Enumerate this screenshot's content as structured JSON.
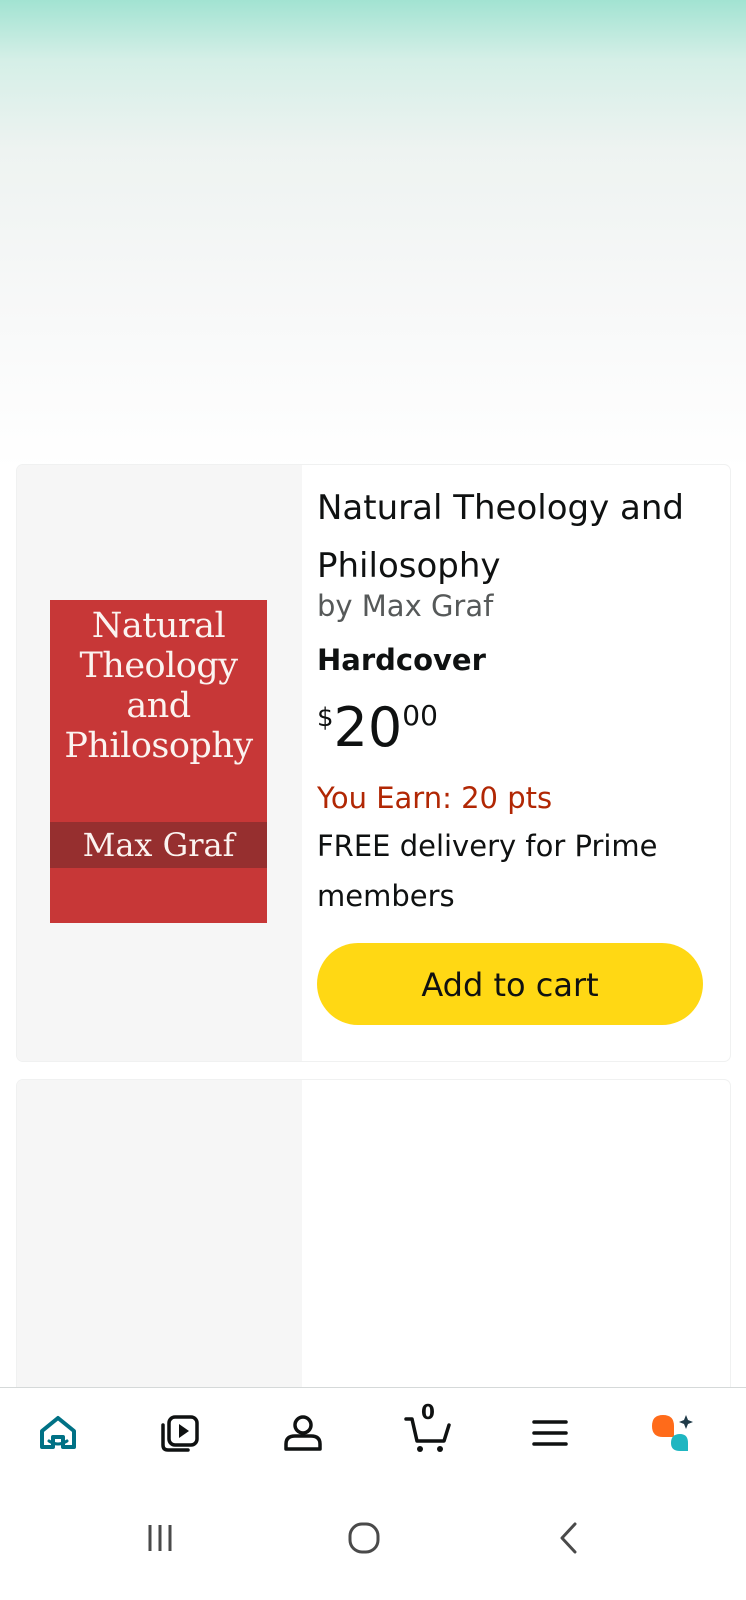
{
  "product": {
    "cover": {
      "title": "Natural Theology and Philosophy",
      "author": "Max Graf",
      "background": "#c73737"
    },
    "title": "Natural Theology and Philosophy",
    "byline": "by Max Graf",
    "format": "Hardcover",
    "price": {
      "symbol": "$",
      "whole": "20",
      "fraction": "00"
    },
    "points": "You Earn: 20 pts",
    "delivery": "FREE delivery for Prime members",
    "add_to_cart_label": "Add to cart"
  },
  "bottom_nav": {
    "items": [
      {
        "name": "home",
        "icon": "home-icon",
        "active": true
      },
      {
        "name": "video",
        "icon": "video-library-icon"
      },
      {
        "name": "account",
        "icon": "account-icon"
      },
      {
        "name": "cart",
        "icon": "cart-icon",
        "badge": "0"
      },
      {
        "name": "menu",
        "icon": "menu-icon"
      },
      {
        "name": "rufus",
        "icon": "ai-assistant-icon"
      }
    ],
    "active_color": "#007185"
  },
  "system_nav": {
    "items": [
      {
        "name": "recent-apps",
        "icon": "recent-apps-icon"
      },
      {
        "name": "home",
        "icon": "circle-home-icon"
      },
      {
        "name": "back",
        "icon": "back-chevron-icon"
      }
    ]
  },
  "colors": {
    "cart_button": "#ffd814",
    "points_text": "#b12704",
    "secondary_text": "#565959"
  }
}
